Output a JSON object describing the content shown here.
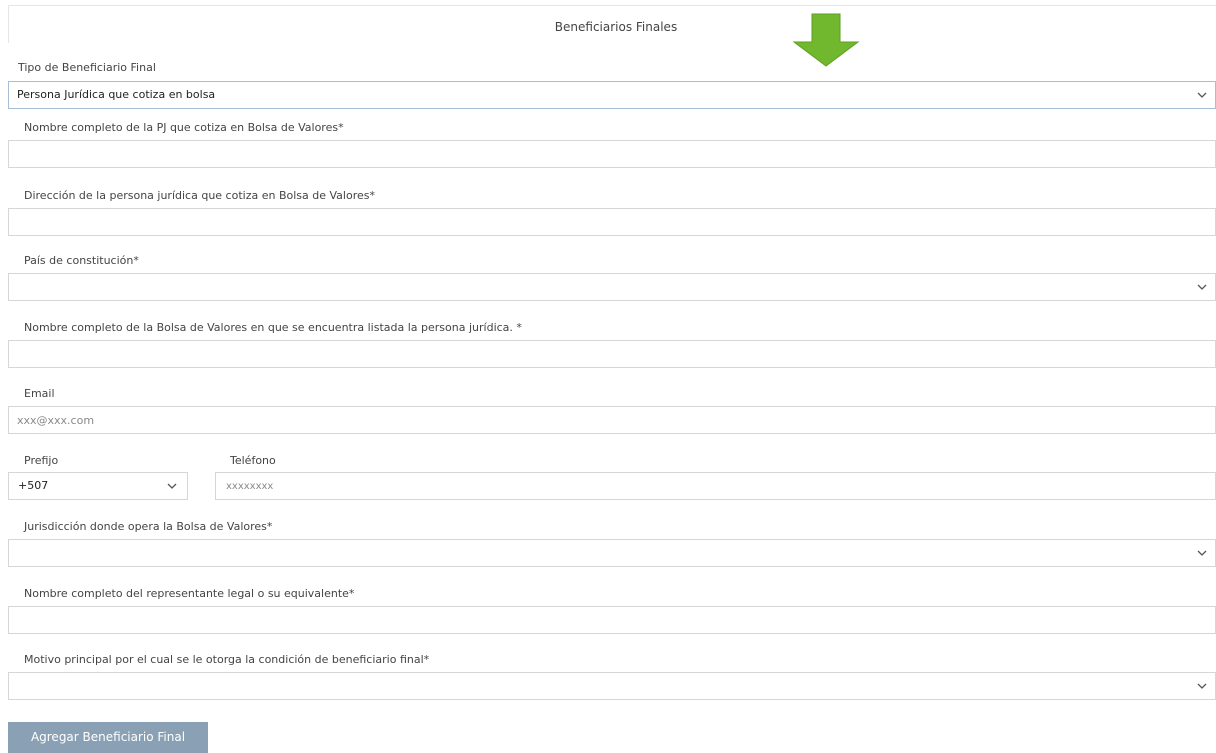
{
  "section": {
    "title": "Beneficiarios Finales"
  },
  "colors": {
    "arrow": "#72b82f",
    "button": "#8aa0b5"
  },
  "fields": {
    "tipo": {
      "label": "Tipo de Beneficiario Final",
      "value": "Persona Jurídica que cotiza en bolsa"
    },
    "nombre_pj": {
      "label": "Nombre completo de la PJ que cotiza en Bolsa de Valores*",
      "value": ""
    },
    "direccion": {
      "label": "Dirección de la persona jurídica que cotiza en Bolsa de Valores*",
      "value": ""
    },
    "pais": {
      "label": "País de constitución*",
      "value": ""
    },
    "bolsa": {
      "label": "Nombre completo de la Bolsa de Valores en que se encuentra listada la persona jurídica. *",
      "value": ""
    },
    "email": {
      "label": "Email",
      "placeholder": "xxx@xxx.com"
    },
    "prefijo": {
      "label": "Prefijo",
      "value": "+507"
    },
    "telefono": {
      "label": "Teléfono",
      "placeholder": "xxxxxxxx"
    },
    "jurisdiccion": {
      "label": "Jurisdicción donde opera la Bolsa de Valores*",
      "value": ""
    },
    "representante": {
      "label": "Nombre completo del representante legal o su equivalente*",
      "value": ""
    },
    "motivo": {
      "label": "Motivo principal por el cual se le otorga la condición de beneficiario final*",
      "value": ""
    }
  },
  "actions": {
    "add_label": "Agregar Beneficiario Final"
  }
}
